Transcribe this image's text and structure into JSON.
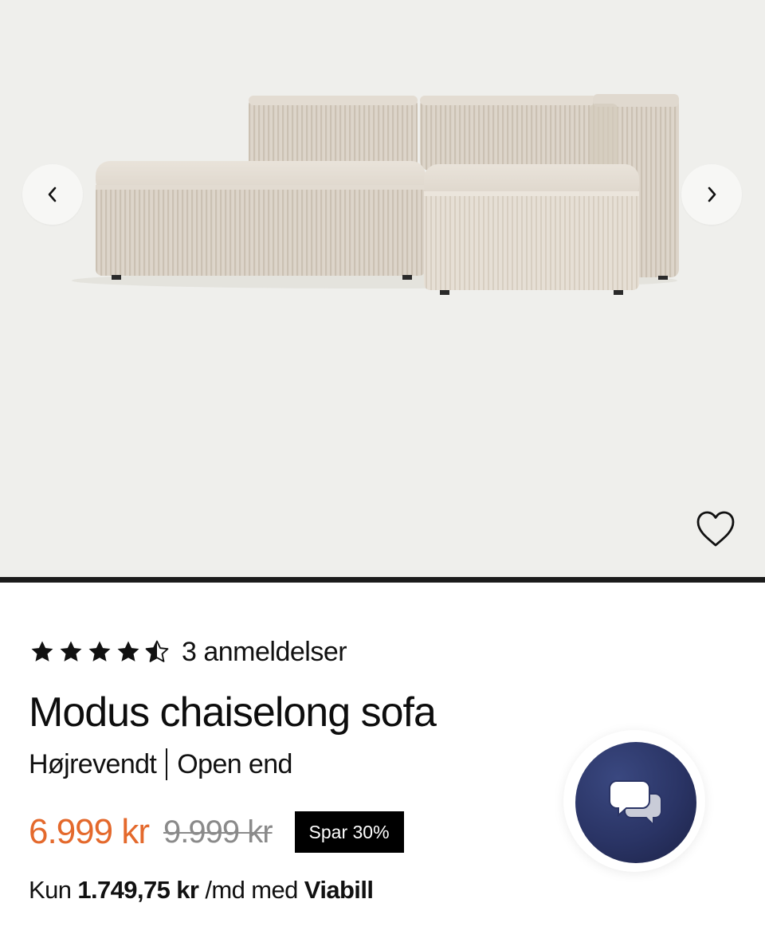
{
  "product": {
    "title": "Modus chaiselong sofa",
    "variant_orientation": "Højrevendt",
    "variant_end": "Open end",
    "rating_stars": 4.5,
    "reviews_label": "3 anmeldelser"
  },
  "pricing": {
    "current": "6.999 kr",
    "original": "9.999 kr",
    "discount_badge": "Spar 30%",
    "financing_prefix": "Kun ",
    "financing_amount": "1.749,75 kr",
    "financing_middle": " /md med ",
    "financing_provider": "Viabill"
  },
  "gallery": {
    "prev_icon": "chevron-left-icon",
    "next_icon": "chevron-right-icon",
    "favorite_icon": "heart-outline-icon"
  },
  "chat": {
    "icon": "chat-bubbles-icon"
  },
  "colors": {
    "price_accent": "#e4692c",
    "badge_bg": "#000000",
    "chat_bg": "#2a3465",
    "gallery_bg": "#efefec"
  }
}
